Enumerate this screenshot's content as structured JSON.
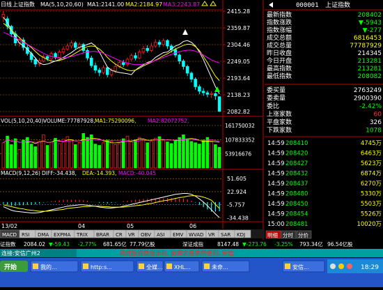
{
  "header": {
    "period_label": "日线",
    "index_name": "上证指数",
    "ma_label": "MA(5,10,20,60)",
    "ma1": "MA1:2141.00",
    "ma2": "MA2:2184.97",
    "ma3": "MA3:2243.87",
    "ma1_color": "#ffffff",
    "ma2_color": "#ffff00",
    "ma3_color": "#ff00ff"
  },
  "price_axis": {
    "labels": [
      "2415.28",
      "2359.87",
      "2304.46",
      "2249.05",
      "2193.64",
      "2138.23",
      "2082.82"
    ]
  },
  "volume_header": {
    "label": "VOL(5,10,20,40)",
    "volume": "VOLUME:77787928,",
    "ma1": "MA1:75290096,",
    "ma2": "MA2:82072752,"
  },
  "volume_axis": {
    "labels": [
      "161750032",
      "107833352",
      "53916676"
    ]
  },
  "macd_header": {
    "label": "MACD(9,12,26)",
    "diff": "DIFF:-34.438,",
    "dea": "DEA:-14.393,",
    "macd": "MACD:-40.045"
  },
  "macd_axis": {
    "labels": [
      "51.605",
      "22.924",
      "-5.757",
      "-34.438"
    ]
  },
  "date_axis": {
    "labels": [
      "13/02",
      "04",
      "05",
      "06"
    ]
  },
  "tabs": [
    "MACD",
    "RSI",
    "DMA",
    "EXPMA",
    "TRIX",
    "BRAR",
    "CR",
    "VR",
    "OBV",
    "ASI",
    "EMV",
    "WVAD",
    "VR",
    "SAR",
    "KDJ"
  ],
  "quote": {
    "code": "000001",
    "name": "上证指数",
    "rows": [
      {
        "label": "最新指数",
        "value": "208402",
        "color": "#00ff00"
      },
      {
        "label": "指数涨跌",
        "value": "▼-5943",
        "color": "#00ff00"
      },
      {
        "label": "指数涨幅",
        "value": "▼-277",
        "color": "#00ff00"
      },
      {
        "label": "成交总额",
        "value": "6816453",
        "color": "#ffff00"
      },
      {
        "label": "成交总量",
        "value": "77787929",
        "color": "#ffff00"
      },
      {
        "label": "昨日收盘",
        "value": "214345",
        "color": "#ffffff"
      },
      {
        "label": "今日开盘",
        "value": "213281",
        "color": "#00ff00"
      },
      {
        "label": "最高指数",
        "value": "213281",
        "color": "#00ff00"
      },
      {
        "label": "最低指数",
        "value": "208082",
        "color": "#00ff00"
      }
    ],
    "order": [
      {
        "label": "委买量",
        "value": "2763249",
        "color": "#ffffff"
      },
      {
        "label": "委卖量",
        "value": "2900390",
        "color": "#ffffff"
      },
      {
        "label": "委比",
        "value": "-2.42%",
        "color": "#00ff00"
      },
      {
        "label": "上涨家数",
        "value": "60",
        "color": "#ff3333"
      },
      {
        "label": "平盘家数",
        "value": "326",
        "color": "#ffffff"
      },
      {
        "label": "下跌家数",
        "value": "1078",
        "color": "#00ff00"
      }
    ],
    "ticks": [
      {
        "time": "14:59",
        "price": "208410",
        "vol": "4745万"
      },
      {
        "time": "14:59",
        "price": "208420",
        "vol": "6463万"
      },
      {
        "time": "14:59",
        "price": "208427",
        "vol": "5623万"
      },
      {
        "time": "14:59",
        "price": "208432",
        "vol": "6874万"
      },
      {
        "time": "14:59",
        "price": "208437",
        "vol": "6270万"
      },
      {
        "time": "14:59",
        "price": "208480",
        "vol": "5330万"
      },
      {
        "time": "14:59",
        "price": "208450",
        "vol": "5503万"
      },
      {
        "time": "14:59",
        "price": "208454",
        "vol": "5526万"
      },
      {
        "time": "15:00",
        "price": "208481",
        "vol": "10020万"
      }
    ],
    "bottom_tabs": [
      "明细",
      "分时",
      "分价"
    ]
  },
  "status_bar": {
    "left_name": "证指数",
    "left_value": "2084.02",
    "left_change": "▼-59.43",
    "left_pct": "-2.77%",
    "left_amount": "681.65亿",
    "left_vol": "77.79亿股",
    "right_name": "深证成指",
    "right_value": "8147.48",
    "right_change": "▼-273.76",
    "right_pct": "-3.25%",
    "right_amount": "793.34亿",
    "right_vol": "96.54亿股"
  },
  "ticker": {
    "left": "连接:安信广州2",
    "scroll": "周线投资数值添利, 股票交易依然便利, 安信"
  },
  "taskbar": {
    "start": "开始",
    "items": [
      "我的...",
      "http:s...",
      "全媒...",
      "XHL...",
      "未命...",
      "安信..."
    ],
    "clock": "18:29"
  },
  "chart_data": [
    {
      "type": "candlestick",
      "title": "上证指数 日线",
      "x_labels": [
        "13/02",
        "04",
        "05",
        "06"
      ],
      "ylim": [
        2082.82,
        2415.28
      ],
      "y_ticks": [
        2415.28,
        2359.87,
        2304.46,
        2249.05,
        2193.64,
        2138.23,
        2082.82
      ],
      "series": [
        {
          "name": "MA1",
          "values": [
            2395,
            2378,
            2352,
            2330,
            2310,
            2300,
            2290,
            2275,
            2260,
            2244,
            2238,
            2240,
            2245,
            2250,
            2255,
            2262,
            2270,
            2278,
            2288,
            2296,
            2300,
            2305,
            2310,
            2300,
            2280,
            2255,
            2230,
            2220,
            2215,
            2212,
            2210,
            2208,
            2205,
            2220,
            2230,
            2238,
            2245,
            2250,
            2262,
            2270,
            2278,
            2280,
            2290,
            2300,
            2305,
            2315,
            2318,
            2312,
            2300,
            2280,
            2255,
            2225,
            2195,
            2165,
            2141
          ]
        },
        {
          "name": "MA2",
          "values": [
            2375,
            2365,
            2352,
            2340,
            2328,
            2315,
            2305,
            2295,
            2282,
            2270,
            2262,
            2255,
            2250,
            2250,
            2252,
            2256,
            2262,
            2268,
            2276,
            2284,
            2292,
            2298,
            2300,
            2298,
            2290,
            2278,
            2262,
            2250,
            2240,
            2232,
            2225,
            2220,
            2218,
            2220,
            2226,
            2234,
            2240,
            2246,
            2253,
            2260,
            2268,
            2274,
            2282,
            2290,
            2296,
            2302,
            2306,
            2305,
            2298,
            2285,
            2265,
            2245,
            2222,
            2200,
            2185
          ]
        },
        {
          "name": "MA3",
          "values": [
            2345,
            2340,
            2333,
            2327,
            2320,
            2312,
            2305,
            2298,
            2290,
            2283,
            2276,
            2270,
            2265,
            2262,
            2260,
            2260,
            2262,
            2265,
            2269,
            2273,
            2277,
            2280,
            2282,
            2282,
            2280,
            2276,
            2270,
            2264,
            2258,
            2252,
            2247,
            2243,
            2240,
            2238,
            2238,
            2240,
            2243,
            2247,
            2252,
            2257,
            2262,
            2267,
            2272,
            2277,
            2281,
            2284,
            2286,
            2286,
            2283,
            2278,
            2270,
            2262,
            2254,
            2248,
            2244
          ]
        }
      ],
      "candles": [
        {
          "o": 2395,
          "c": 2405,
          "h": 2415,
          "l": 2380
        },
        {
          "o": 2390,
          "c": 2365,
          "h": 2398,
          "l": 2355
        },
        {
          "o": 2365,
          "c": 2340,
          "h": 2370,
          "l": 2330
        },
        {
          "o": 2340,
          "c": 2310,
          "h": 2350,
          "l": 2300
        },
        {
          "o": 2310,
          "c": 2322,
          "h": 2330,
          "l": 2298
        },
        {
          "o": 2320,
          "c": 2295,
          "h": 2328,
          "l": 2285
        },
        {
          "o": 2295,
          "c": 2275,
          "h": 2305,
          "l": 2268
        },
        {
          "o": 2275,
          "c": 2255,
          "h": 2282,
          "l": 2245
        },
        {
          "o": 2255,
          "c": 2240,
          "h": 2262,
          "l": 2230
        },
        {
          "o": 2240,
          "c": 2252,
          "h": 2260,
          "l": 2232
        },
        {
          "o": 2250,
          "c": 2265,
          "h": 2272,
          "l": 2245
        },
        {
          "o": 2265,
          "c": 2258,
          "h": 2270,
          "l": 2250
        },
        {
          "o": 2258,
          "c": 2275,
          "h": 2282,
          "l": 2252
        },
        {
          "o": 2275,
          "c": 2262,
          "h": 2280,
          "l": 2255
        },
        {
          "o": 2262,
          "c": 2280,
          "h": 2288,
          "l": 2258
        },
        {
          "o": 2280,
          "c": 2290,
          "h": 2298,
          "l": 2272
        },
        {
          "o": 2290,
          "c": 2300,
          "h": 2308,
          "l": 2284
        },
        {
          "o": 2300,
          "c": 2310,
          "h": 2318,
          "l": 2292
        },
        {
          "o": 2310,
          "c": 2295,
          "h": 2316,
          "l": 2288
        },
        {
          "o": 2295,
          "c": 2305,
          "h": 2312,
          "l": 2288
        },
        {
          "o": 2305,
          "c": 2285,
          "h": 2310,
          "l": 2278
        },
        {
          "o": 2285,
          "c": 2260,
          "h": 2292,
          "l": 2252
        },
        {
          "o": 2260,
          "c": 2235,
          "h": 2268,
          "l": 2228
        },
        {
          "o": 2235,
          "c": 2220,
          "h": 2245,
          "l": 2210
        },
        {
          "o": 2220,
          "c": 2212,
          "h": 2228,
          "l": 2200
        },
        {
          "o": 2212,
          "c": 2228,
          "h": 2236,
          "l": 2205
        },
        {
          "o": 2228,
          "c": 2205,
          "h": 2232,
          "l": 2196
        },
        {
          "o": 2205,
          "c": 2218,
          "h": 2226,
          "l": 2198
        },
        {
          "o": 2218,
          "c": 2232,
          "h": 2240,
          "l": 2210
        },
        {
          "o": 2232,
          "c": 2245,
          "h": 2252,
          "l": 2226
        },
        {
          "o": 2245,
          "c": 2238,
          "h": 2254,
          "l": 2230
        },
        {
          "o": 2238,
          "c": 2256,
          "h": 2262,
          "l": 2232
        },
        {
          "o": 2256,
          "c": 2268,
          "h": 2275,
          "l": 2250
        },
        {
          "o": 2268,
          "c": 2260,
          "h": 2278,
          "l": 2252
        },
        {
          "o": 2260,
          "c": 2280,
          "h": 2288,
          "l": 2256
        },
        {
          "o": 2280,
          "c": 2292,
          "h": 2300,
          "l": 2272
        },
        {
          "o": 2292,
          "c": 2285,
          "h": 2302,
          "l": 2278
        },
        {
          "o": 2285,
          "c": 2300,
          "h": 2310,
          "l": 2280
        },
        {
          "o": 2300,
          "c": 2312,
          "h": 2322,
          "l": 2294
        },
        {
          "o": 2312,
          "c": 2305,
          "h": 2320,
          "l": 2296
        },
        {
          "o": 2305,
          "c": 2318,
          "h": 2325,
          "l": 2298
        },
        {
          "o": 2318,
          "c": 2300,
          "h": 2322,
          "l": 2290
        },
        {
          "o": 2300,
          "c": 2288,
          "h": 2306,
          "l": 2278
        },
        {
          "o": 2288,
          "c": 2270,
          "h": 2294,
          "l": 2262
        },
        {
          "o": 2270,
          "c": 2250,
          "h": 2275,
          "l": 2240
        },
        {
          "o": 2250,
          "c": 2232,
          "h": 2256,
          "l": 2222
        },
        {
          "o": 2232,
          "c": 2210,
          "h": 2238,
          "l": 2200
        },
        {
          "o": 2210,
          "c": 2190,
          "h": 2215,
          "l": 2180
        },
        {
          "o": 2190,
          "c": 2165,
          "h": 2196,
          "l": 2155
        },
        {
          "o": 2165,
          "c": 2150,
          "h": 2172,
          "l": 2140
        },
        {
          "o": 2150,
          "c": 2145,
          "h": 2160,
          "l": 2135
        },
        {
          "o": 2145,
          "c": 2140,
          "h": 2152,
          "l": 2130
        },
        {
          "o": 2140,
          "c": 2142,
          "h": 2150,
          "l": 2128
        },
        {
          "o": 2142,
          "c": 2135,
          "h": 2146,
          "l": 2122
        },
        {
          "o": 2132,
          "c": 2084,
          "h": 2133,
          "l": 2081
        }
      ]
    },
    {
      "type": "bar",
      "title": "VOL(5,10,20,40)",
      "ylim": [
        0,
        161750032
      ],
      "y_ticks": [
        161750032,
        107833352,
        53916676
      ],
      "values": [
        95,
        120,
        88,
        110,
        70,
        105,
        115,
        90,
        80,
        100,
        125,
        85,
        98,
        112,
        92,
        108,
        118,
        102,
        88,
        96,
        130,
        115,
        125,
        90,
        85,
        95,
        105,
        100,
        88,
        92,
        110,
        120,
        98,
        105,
        115,
        108,
        95,
        100,
        112,
        118,
        105,
        98,
        92,
        105,
        115,
        125,
        110,
        100,
        95,
        90,
        105,
        115,
        98,
        88,
        78
      ],
      "colors": [
        "r",
        "g",
        "g",
        "g",
        "r",
        "g",
        "g",
        "g",
        "g",
        "r",
        "r",
        "g",
        "r",
        "g",
        "r",
        "r",
        "r",
        "r",
        "g",
        "r",
        "g",
        "g",
        "g",
        "g",
        "g",
        "r",
        "g",
        "r",
        "r",
        "r",
        "g",
        "r",
        "r",
        "g",
        "r",
        "r",
        "g",
        "r",
        "r",
        "g",
        "r",
        "g",
        "g",
        "g",
        "g",
        "g",
        "g",
        "g",
        "g",
        "g",
        "g",
        "g",
        "r",
        "g",
        "g"
      ]
    },
    {
      "type": "line",
      "title": "MACD(9,12,26)",
      "ylim": [
        -40,
        55
      ],
      "y_ticks": [
        51.605,
        22.924,
        -5.757,
        -34.438
      ],
      "series": [
        {
          "name": "DIFF",
          "values": [
            -10,
            -14,
            -18,
            -20,
            -21,
            -22,
            -23,
            -24,
            -24,
            -23,
            -21,
            -19,
            -17,
            -15,
            -13,
            -11,
            -9,
            -8,
            -7,
            -6,
            -6,
            -7,
            -8,
            -9,
            -11,
            -12,
            -13,
            -13,
            -12,
            -11,
            -9,
            -7,
            -5,
            -3,
            -1,
            1,
            3,
            5,
            7,
            9,
            11,
            13,
            15,
            17,
            18,
            19,
            19,
            17,
            13,
            7,
            0,
            -8,
            -17,
            -26,
            -34
          ]
        },
        {
          "name": "DEA",
          "values": [
            -6,
            -8,
            -10,
            -12,
            -14,
            -15,
            -17,
            -18,
            -19,
            -20,
            -20,
            -20,
            -19,
            -18,
            -17,
            -16,
            -14,
            -13,
            -12,
            -11,
            -10,
            -10,
            -9,
            -9,
            -9,
            -10,
            -10,
            -11,
            -11,
            -11,
            -11,
            -10,
            -9,
            -8,
            -7,
            -6,
            -4,
            -3,
            -1,
            1,
            3,
            4,
            6,
            8,
            10,
            11,
            13,
            14,
            14,
            13,
            11,
            8,
            4,
            -5,
            -14
          ]
        }
      ],
      "macd_bars": [
        -8,
        -12,
        -16,
        -16,
        -14,
        -14,
        -12,
        -12,
        -10,
        -6,
        -2,
        2,
        4,
        6,
        8,
        10,
        10,
        10,
        10,
        10,
        8,
        6,
        2,
        0,
        -4,
        -4,
        -6,
        -4,
        -2,
        0,
        4,
        6,
        8,
        10,
        12,
        14,
        14,
        16,
        16,
        16,
        16,
        18,
        18,
        18,
        16,
        16,
        12,
        6,
        -2,
        -12,
        -22,
        -32,
        -42,
        -42,
        -40
      ]
    }
  ]
}
